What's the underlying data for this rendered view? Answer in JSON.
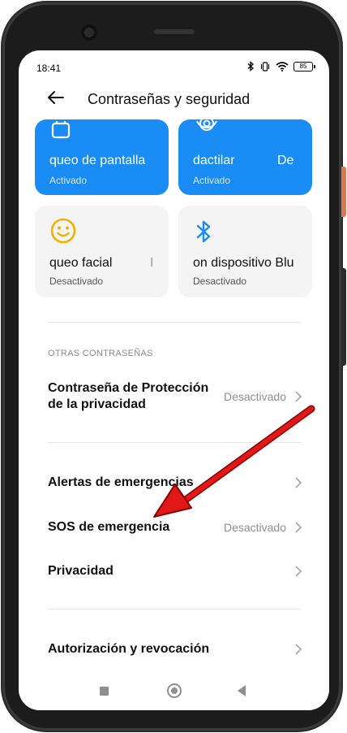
{
  "status_bar": {
    "time": "18:41",
    "battery": "85"
  },
  "header": {
    "title": "Contraseñas y seguridad"
  },
  "tiles": [
    {
      "label": "queo de pantalla",
      "status": "Activado",
      "icon": "lock-icon"
    },
    {
      "label": "dactilar",
      "label_extra": "De",
      "status": "Activado",
      "icon": "fingerprint-icon"
    },
    {
      "label": "queo facial",
      "label_extra": "I",
      "status": "Desactivado",
      "icon": "face-icon"
    },
    {
      "label": "on dispositivo Blu",
      "status": "Desactivado",
      "icon": "bluetooth-icon"
    }
  ],
  "section": {
    "title": "OTRAS CONTRASEÑAS"
  },
  "rows": [
    {
      "label_line1": "Contraseña de Protección",
      "label_line2": "de la privacidad",
      "value": "Desactivado"
    },
    {
      "label": "Alertas de emergencias",
      "value": ""
    },
    {
      "label": "SOS de emergencia",
      "value": "Desactivado"
    },
    {
      "label": "Privacidad",
      "value": ""
    },
    {
      "label": "Autorización y revocación",
      "value": ""
    }
  ],
  "colors": {
    "accent_blue": "#1a8cf5",
    "arrow_red": "#e01818",
    "face_yellow": "#f2b300"
  }
}
